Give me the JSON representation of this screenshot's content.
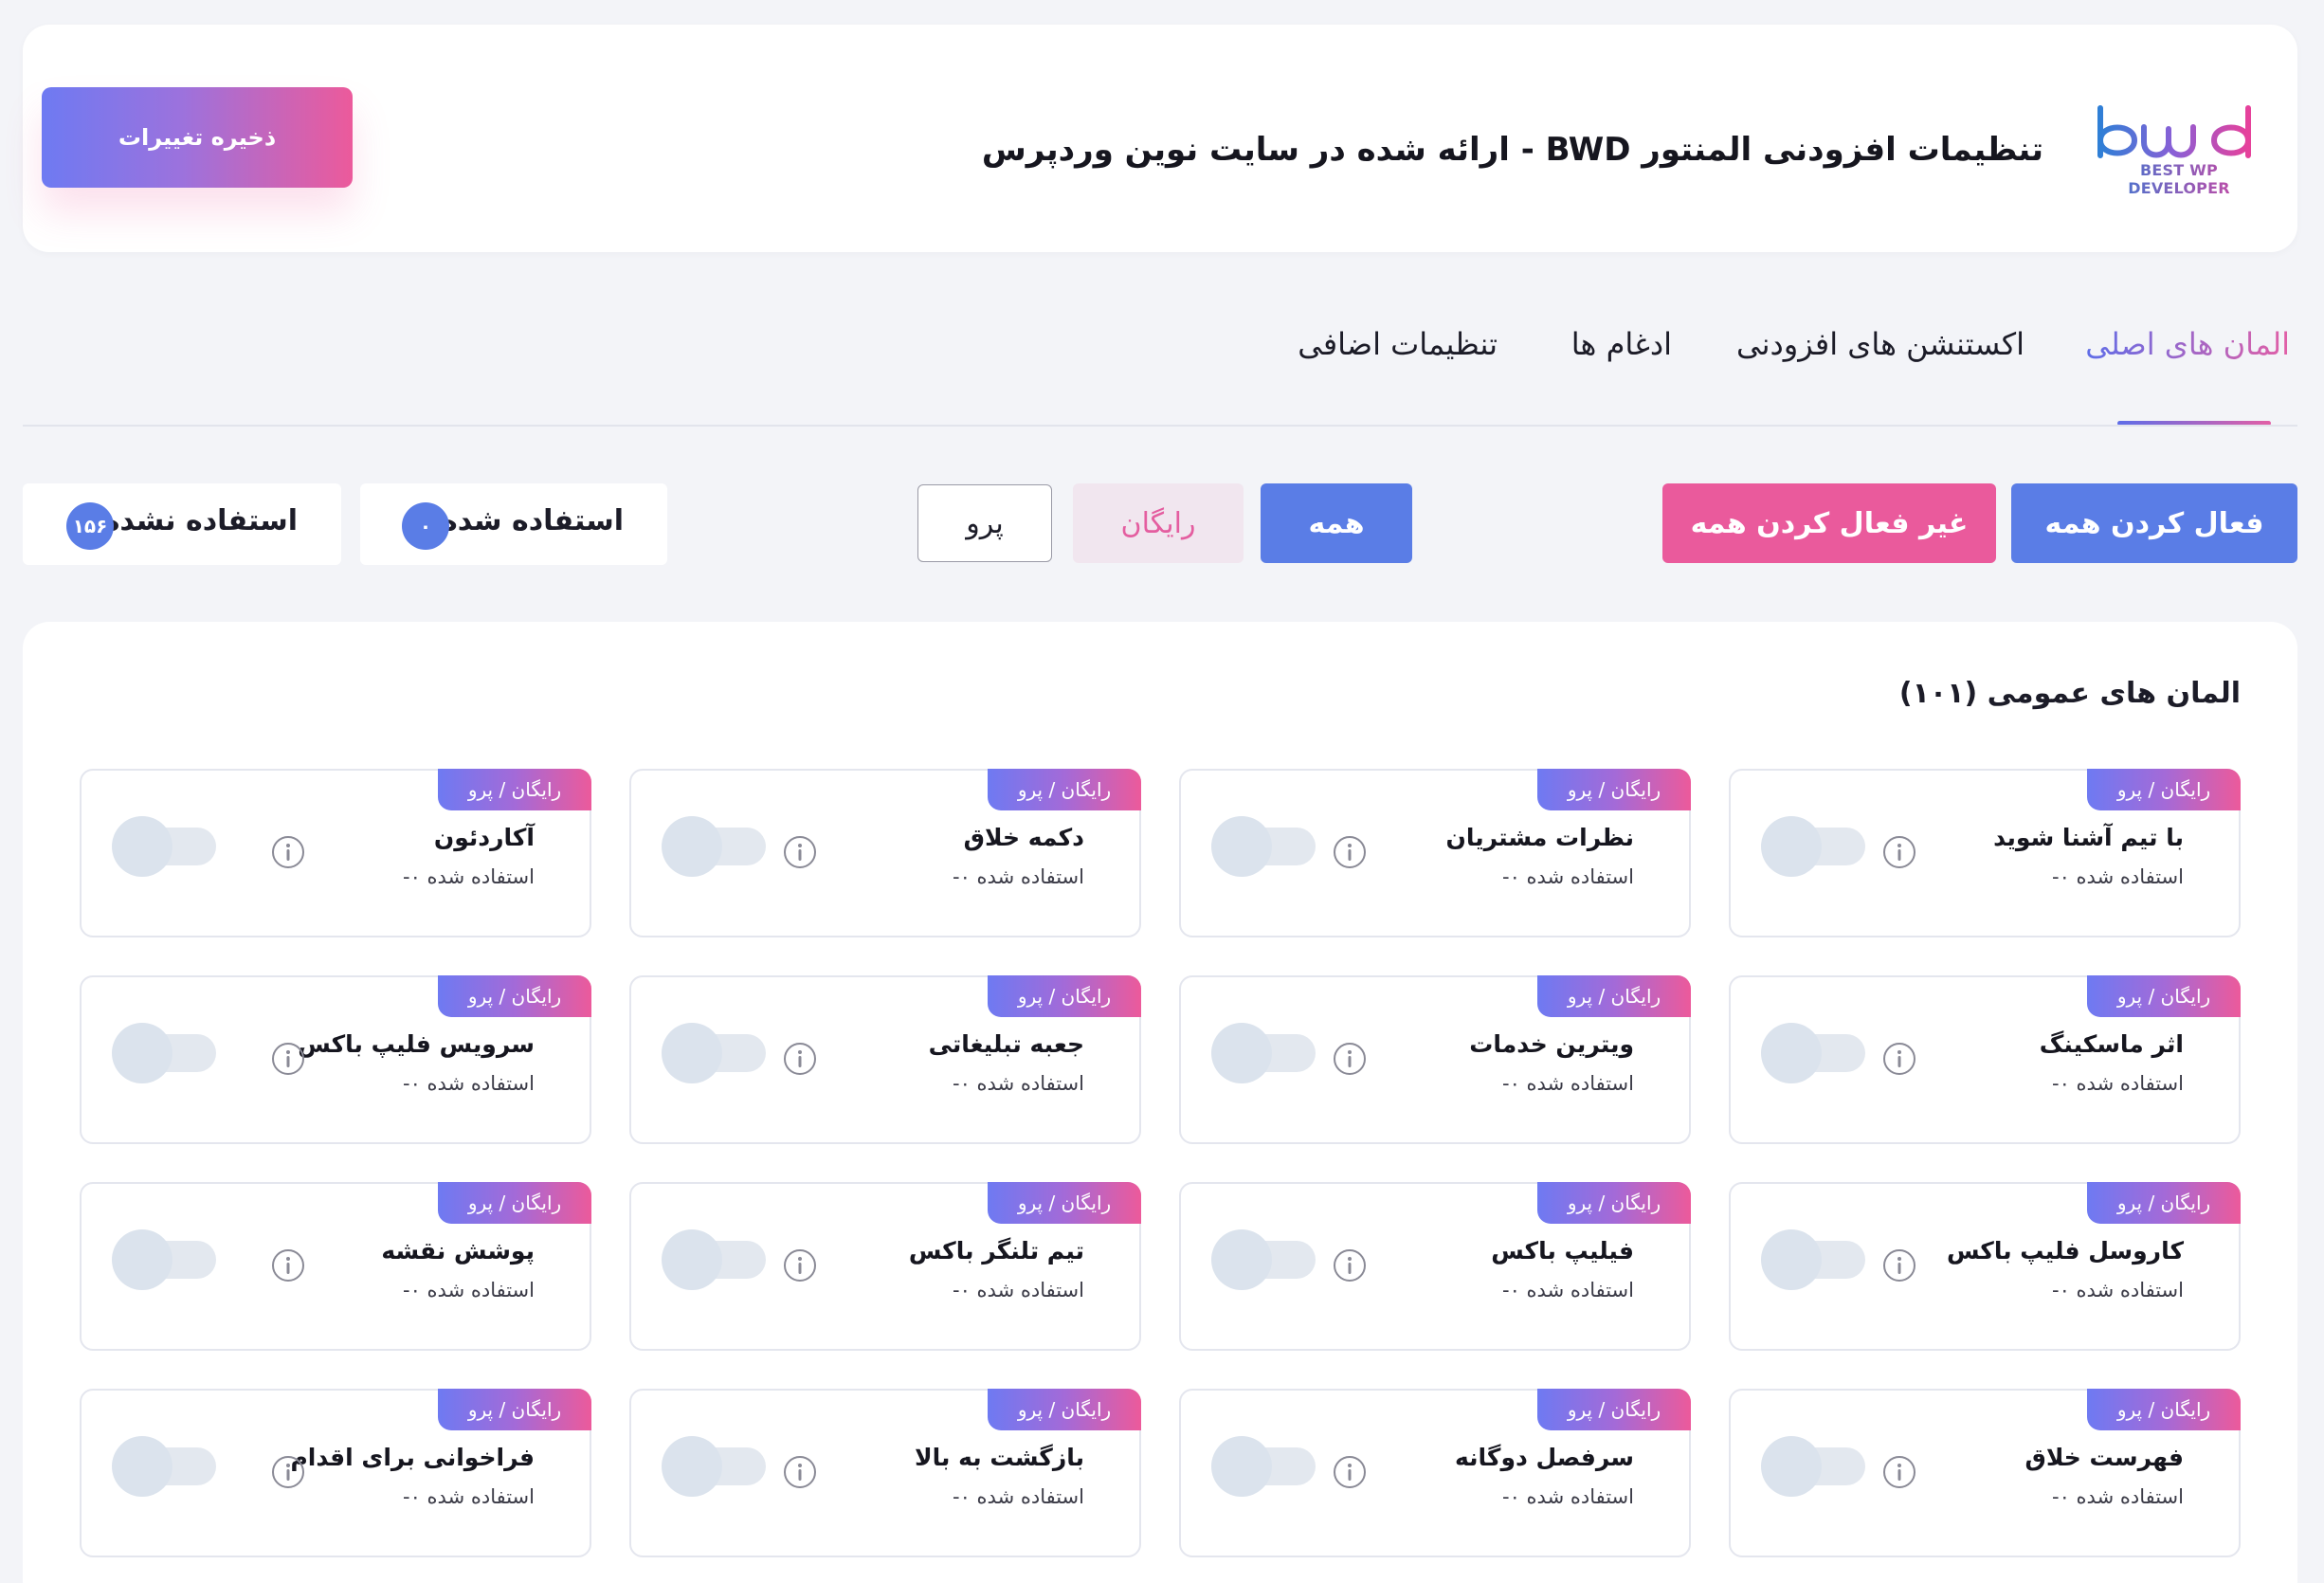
{
  "header": {
    "logo_text": "BEST WP DEVELOPER",
    "title": "تنظیمات افزودنی المنتور BWD - ارائه شده در سایت نوین وردپرس",
    "save_label": "ذخیره تغییرات"
  },
  "tabs": [
    {
      "label": "المان های اصلی",
      "active": true
    },
    {
      "label": "اکستنشن های افزودنی",
      "active": false
    },
    {
      "label": "ادغام ها",
      "active": false
    },
    {
      "label": "تنظیمات اضافی",
      "active": false
    }
  ],
  "actions": {
    "activate_all": "فعال کردن همه",
    "deactivate_all": "غیر فعال کردن همه"
  },
  "filters": {
    "all": "همه",
    "free": "رایگان",
    "pro": "پرو"
  },
  "stats": {
    "used_label": "استفاده شده",
    "used_count": "۰",
    "unused_label": "استفاده نشده",
    "unused_count": "۱۵۶"
  },
  "section": {
    "title": "المان های عمومی (۱۰۱)"
  },
  "colors": {
    "accent_blue": "#5a7de6",
    "accent_pink": "#ea5a9c",
    "page_bg": "#f3f4f8"
  },
  "widgets": [
    {
      "badge": "رایگان / پرو",
      "name": "با تیم آشنا شوید",
      "usage": "استفاده شده ۰-",
      "enabled": false
    },
    {
      "badge": "رایگان / پرو",
      "name": "نظرات مشتریان",
      "usage": "استفاده شده ۰-",
      "enabled": false
    },
    {
      "badge": "رایگان / پرو",
      "name": "دکمه خلاق",
      "usage": "استفاده شده ۰-",
      "enabled": false
    },
    {
      "badge": "رایگان / پرو",
      "name": "آکاردئون",
      "usage": "استفاده شده ۰-",
      "enabled": false
    },
    {
      "badge": "رایگان / پرو",
      "name": "اثر ماسکینگ",
      "usage": "استفاده شده ۰-",
      "enabled": false
    },
    {
      "badge": "رایگان / پرو",
      "name": "ویترین خدمات",
      "usage": "استفاده شده ۰-",
      "enabled": false
    },
    {
      "badge": "رایگان / پرو",
      "name": "جعبه تبلیغاتی",
      "usage": "استفاده شده ۰-",
      "enabled": false
    },
    {
      "badge": "رایگان / پرو",
      "name": "سرویس فلیپ باکس",
      "usage": "استفاده شده ۰-",
      "enabled": false
    },
    {
      "badge": "رایگان / پرو",
      "name": "کاروسل فلیپ باکس",
      "usage": "استفاده شده ۰-",
      "enabled": false
    },
    {
      "badge": "رایگان / پرو",
      "name": "فیلیپ باکس",
      "usage": "استفاده شده ۰-",
      "enabled": false
    },
    {
      "badge": "رایگان / پرو",
      "name": "تیم تلنگر باکس",
      "usage": "استفاده شده ۰-",
      "enabled": false
    },
    {
      "badge": "رایگان / پرو",
      "name": "پوشش نقشه",
      "usage": "استفاده شده ۰-",
      "enabled": false
    },
    {
      "badge": "رایگان / پرو",
      "name": "فهرست خلاق",
      "usage": "استفاده شده ۰-",
      "enabled": false
    },
    {
      "badge": "رایگان / پرو",
      "name": "سرفصل دوگانه",
      "usage": "استفاده شده ۰-",
      "enabled": false
    },
    {
      "badge": "رایگان / پرو",
      "name": "بازگشت به بالا",
      "usage": "استفاده شده ۰-",
      "enabled": false
    },
    {
      "badge": "رایگان / پرو",
      "name": "فراخوانی برای اقدام",
      "usage": "استفاده شده ۰-",
      "enabled": false
    }
  ]
}
